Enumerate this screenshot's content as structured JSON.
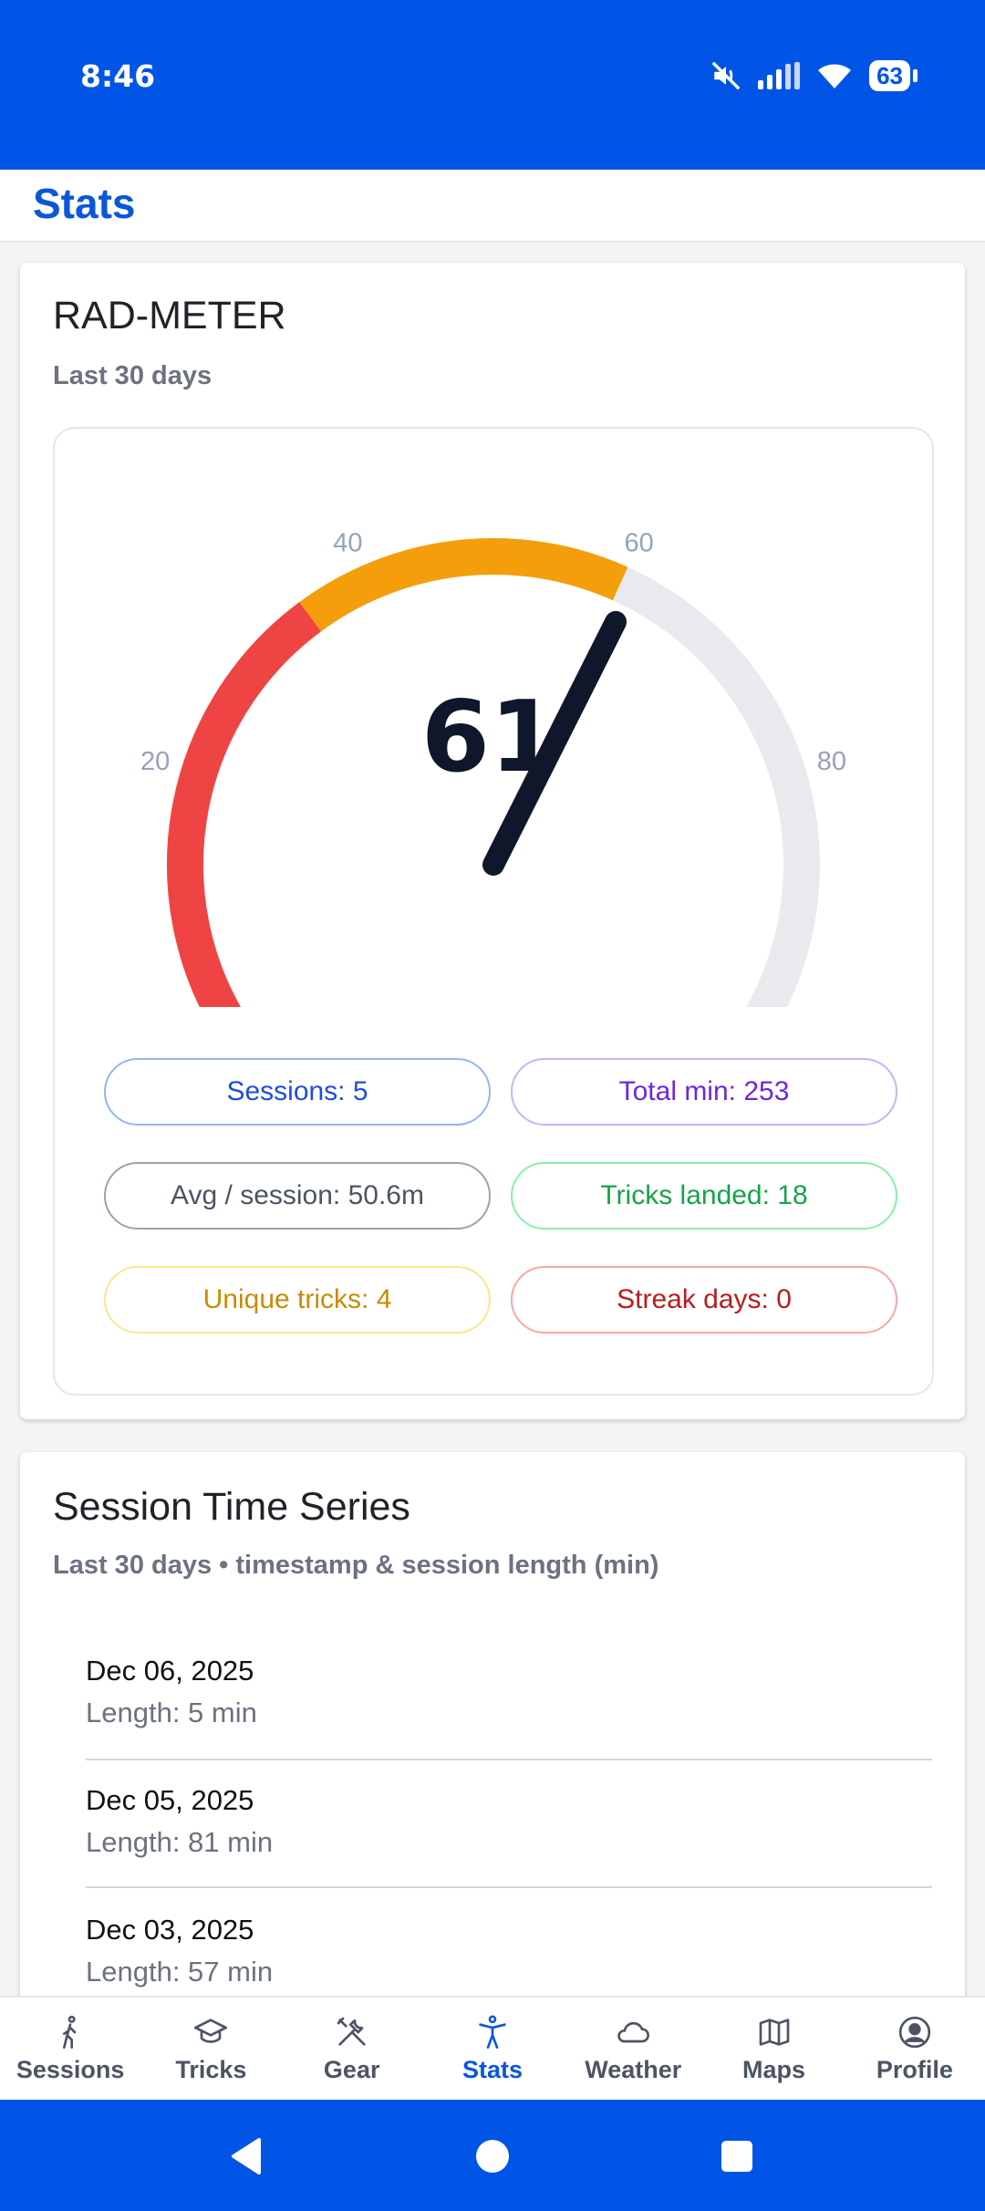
{
  "status": {
    "time": "8:46",
    "battery": "63"
  },
  "appbar": {
    "title": "Stats"
  },
  "radmeter": {
    "title": "RAD-METER",
    "subtitle": "Last 30 days",
    "gauge": {
      "value": "61",
      "value_num": 61,
      "min": 0,
      "max": 100,
      "tick_labels": [
        "20",
        "40",
        "60",
        "80"
      ],
      "colors": {
        "low": "#ef4444",
        "mid": "#f59e0b",
        "track": "#e9eaee",
        "needle": "#0f172a"
      }
    },
    "stats": [
      {
        "label": "Sessions: 5",
        "color": "#1d4ed8",
        "border": "#93b4f5"
      },
      {
        "label": "Total min: 253",
        "color": "#6d28d9",
        "border": "#c4b5fd"
      },
      {
        "label": "Avg / session: 50.6m",
        "color": "#4b5563",
        "border": "#9ca3af"
      },
      {
        "label": "Tricks landed: 18",
        "color": "#16a34a",
        "border": "#86efac"
      },
      {
        "label": "Unique tricks: 4",
        "color": "#ca8a04",
        "border": "#fde68a"
      },
      {
        "label": "Streak days: 0",
        "color": "#b91c1c",
        "border": "#fca5a5"
      }
    ]
  },
  "timeseries": {
    "title": "Session Time Series",
    "subtitle": "Last 30 days • timestamp & session length (min)",
    "items": [
      {
        "date": "Dec 06, 2025",
        "length": "Length: 5 min"
      },
      {
        "date": "Dec 05, 2025",
        "length": "Length: 81 min"
      },
      {
        "date": "Dec 03, 2025",
        "length": "Length: 57 min"
      }
    ]
  },
  "nav": {
    "items": [
      {
        "label": "Sessions",
        "icon": "walking-person-icon"
      },
      {
        "label": "Tricks",
        "icon": "graduation-cap-icon"
      },
      {
        "label": "Gear",
        "icon": "tools-icon"
      },
      {
        "label": "Stats",
        "icon": "accessibility-person-icon",
        "active": true
      },
      {
        "label": "Weather",
        "icon": "cloud-icon"
      },
      {
        "label": "Maps",
        "icon": "map-icon"
      },
      {
        "label": "Profile",
        "icon": "user-circle-icon"
      }
    ]
  }
}
